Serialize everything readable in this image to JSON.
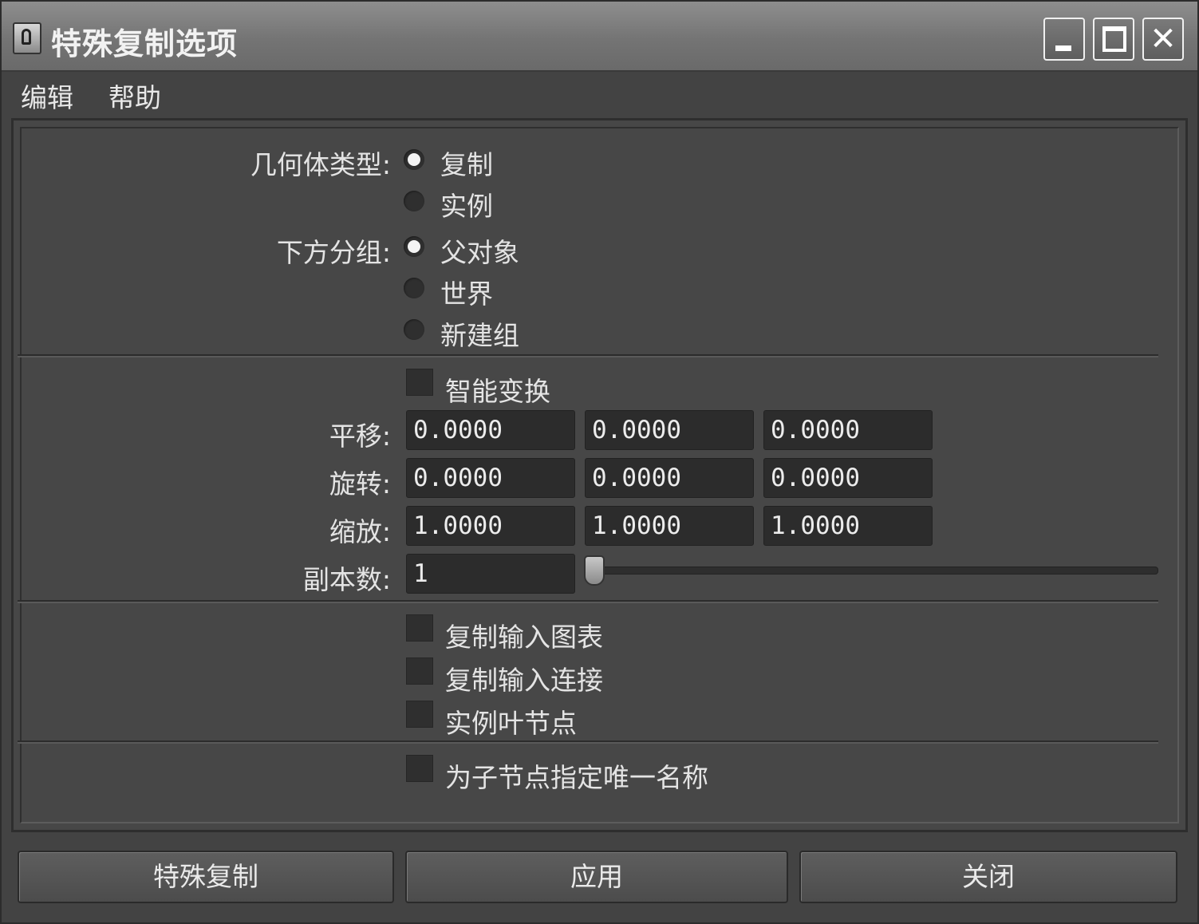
{
  "window": {
    "title": "特殊复制选项"
  },
  "titlebar_buttons": {
    "minimize": "minimize-icon",
    "maximize": "maximize-icon",
    "close": "close-icon",
    "close_glyph": "✕"
  },
  "menu": {
    "edit": "编辑",
    "help": "帮助"
  },
  "geometry_type": {
    "label": "几何体类型:",
    "options": [
      {
        "label": "复制",
        "selected": true
      },
      {
        "label": "实例",
        "selected": false
      }
    ]
  },
  "group_under": {
    "label": "下方分组:",
    "options": [
      {
        "label": "父对象",
        "selected": true
      },
      {
        "label": "世界",
        "selected": false
      },
      {
        "label": "新建组",
        "selected": false
      }
    ]
  },
  "smart_transform": {
    "label": "智能变换",
    "checked": false
  },
  "translate": {
    "label": "平移:",
    "values": [
      "0.0000",
      "0.0000",
      "0.0000"
    ]
  },
  "rotate": {
    "label": "旋转:",
    "values": [
      "0.0000",
      "0.0000",
      "0.0000"
    ]
  },
  "scale": {
    "label": "缩放:",
    "values": [
      "1.0000",
      "1.0000",
      "1.0000"
    ]
  },
  "copies": {
    "label": "副本数:",
    "value": "1"
  },
  "options": [
    {
      "label": "复制输入图表",
      "checked": false
    },
    {
      "label": "复制输入连接",
      "checked": false
    },
    {
      "label": "实例叶节点",
      "checked": false
    }
  ],
  "unique_names": {
    "label": "为子节点指定唯一名称",
    "checked": false
  },
  "buttons": {
    "duplicate_special": "特殊复制",
    "apply": "应用",
    "close": "关闭"
  }
}
